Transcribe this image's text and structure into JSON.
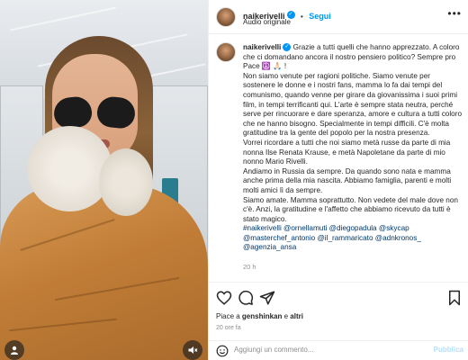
{
  "header": {
    "username": "naikerivelli",
    "separator": "•",
    "follow_label": "Segui",
    "audio_label": "Audio originale"
  },
  "caption": {
    "username": "naikerivelli",
    "p1": "Grazie a tutti quelli che hanno apprezzato. A coloro che ci domandano ancora il nostro pensiero politico? Sempre pro Pace ☮️ 🙏🏻 !",
    "p2": "Non siamo venute per ragioni politiche. Siamo venute per sostenere le donne e i nostri fans, mamma lo fa dai tempi del comunismo, quando venne per girare da giovanissima i suoi primi film, in tempi terrificanti qui. L'arte è sempre stata neutra, perché serve per rincuorare e dare speranza, amore e cultura a tutti coloro che ne hanno bisogno. Specialmente in tempi difficili. C'è molta gratitudine tra la gente del popolo per la nostra presenza.",
    "p3": "Vorrei ricordare a tutti che noi siamo metà russe da parte di mia nonna Ilse Renata Krause, e metà Napoletane da parte di mio nonno Mario Rivelli.",
    "p4": "Andiamo in Russia da sempre. Da quando sono nata e mamma anche prima della mia nascita. Abbiamo famiglia, parenti e molti molti amici lì da sempre.",
    "p5": "Siamo amate. Mamma soprattutto. Non vedete del male dove non c'è. Anzi, la gratitudine e l'affetto che abbiamo ricevuto da tutti è stato magico.",
    "mentions": "#naikerivelli @ornellamuti @diegopadula @skycap @masterchef_antonio @il_rammaricato @adnkronos_ @agenzia_ansa",
    "time": "20 h"
  },
  "likes": {
    "prefix": "Piace a",
    "user1": "genshinkan",
    "mid": "e",
    "others": "altri"
  },
  "date": "20 ore fa",
  "comment": {
    "placeholder": "Aggiungi un commento...",
    "publish_label": "Pubblica"
  },
  "icons": {
    "like": "heart-icon",
    "comment": "comment-icon",
    "share": "paper-plane-icon",
    "save": "bookmark-icon",
    "emoji": "smiley-icon",
    "audio": "speaker-muted-icon",
    "tag": "person-tag-icon",
    "more": "more-horizontal-icon"
  },
  "colors": {
    "accent": "#0095f6",
    "mention": "#00376b",
    "muted_text": "#8e8e8e"
  }
}
